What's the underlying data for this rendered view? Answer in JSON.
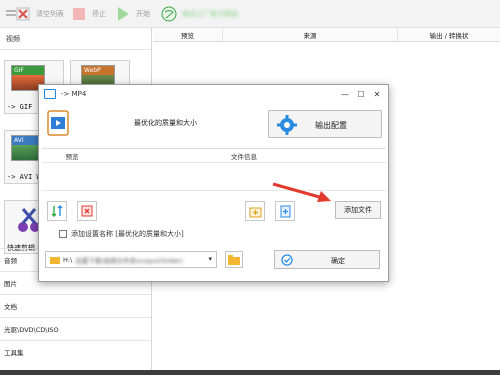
{
  "toolbar": {
    "clear_label": "清空列表",
    "stop_label": "停止",
    "start_label": "开始",
    "site_text": "格式工厂官方网站"
  },
  "sidebar": {
    "header": "视频",
    "tiles": [
      {
        "badge": "GIF",
        "label": "-> GIF"
      },
      {
        "badge": "WebP",
        "label": ""
      },
      {
        "badge": "AVI",
        "label": "-> AVI W"
      },
      {
        "badge": "",
        "label": ""
      },
      {
        "badge": "",
        "label": "快速剪辑"
      }
    ],
    "items": [
      "音频",
      "图片",
      "文档",
      "光驱\\DVD\\CD\\ISO",
      "工具集"
    ]
  },
  "main": {
    "columns": [
      "预览",
      "来源",
      "输出 / 转换状"
    ]
  },
  "dialog": {
    "title": "-> MP4",
    "preset_name": "最优化的质量和大小",
    "output_config_label": "输出配置",
    "table_columns": [
      "预览",
      "文件信息"
    ],
    "add_file_label": "添加文件",
    "checkbox_label": "添加设置名称 [最优化的质量和大小]",
    "path_prefix": "H:\\",
    "path_value": "迅雷下载\\视频文件夹\\output\\folder\\",
    "ok_label": "确定"
  },
  "colors": {
    "accent_blue": "#1e88e5",
    "green": "#2eaa3c",
    "arrow_red": "#e23b2e",
    "folder_yellow": "#f2b632"
  }
}
